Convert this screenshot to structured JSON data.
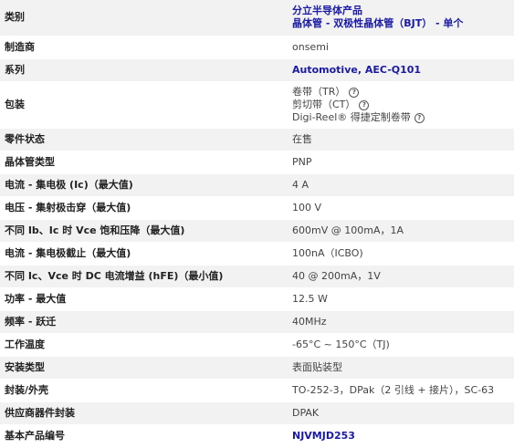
{
  "rows": [
    {
      "label": "类别",
      "lines": [
        "分立半导体产品",
        "晶体管 - 双极性晶体管（BJT） - 单个"
      ],
      "link": true
    },
    {
      "label": "制造商",
      "lines": [
        "onsemi"
      ]
    },
    {
      "label": "系列",
      "lines": [
        "Automotive, AEC-Q101"
      ],
      "link": true
    },
    {
      "label": "包装",
      "lines": [
        "卷带（TR）",
        "剪切带（CT）",
        "Digi-Reel® 得捷定制卷带"
      ],
      "help": true
    },
    {
      "label": "零件状态",
      "lines": [
        "在售"
      ]
    },
    {
      "label": "晶体管类型",
      "lines": [
        "PNP"
      ]
    },
    {
      "label": "电流 - 集电极 (Ic)（最大值)",
      "lines": [
        "4 A"
      ]
    },
    {
      "label": "电压 - 集射极击穿（最大值)",
      "lines": [
        "100 V"
      ]
    },
    {
      "label": "不同 Ib、Ic 时 Vce 饱和压降（最大值)",
      "lines": [
        "600mV @ 100mA，1A"
      ]
    },
    {
      "label": "电流 - 集电极截止（最大值)",
      "lines": [
        "100nA（ICBO)"
      ]
    },
    {
      "label": "不同 Ic、Vce 时 DC 电流增益 (hFE)（最小值)",
      "lines": [
        "40 @ 200mA，1V"
      ]
    },
    {
      "label": "功率 - 最大值",
      "lines": [
        "12.5 W"
      ]
    },
    {
      "label": "频率 - 跃迁",
      "lines": [
        "40MHz"
      ]
    },
    {
      "label": "工作温度",
      "lines": [
        "-65°C ~ 150°C（TJ)"
      ]
    },
    {
      "label": "安装类型",
      "lines": [
        "表面贴装型"
      ]
    },
    {
      "label": "封装/外壳",
      "lines": [
        "TO-252-3，DPak（2 引线 + 接片），SC-63"
      ]
    },
    {
      "label": "供应商器件封装",
      "lines": [
        "DPAK"
      ]
    },
    {
      "label": "基本产品编号",
      "lines": [
        "NJVMJD253"
      ],
      "link": true
    }
  ],
  "icons": {
    "help": "help-circle-icon",
    "help_glyph": "?"
  },
  "colors": {
    "link": "#1a1aa6",
    "stripe": "#f2f2f2"
  }
}
